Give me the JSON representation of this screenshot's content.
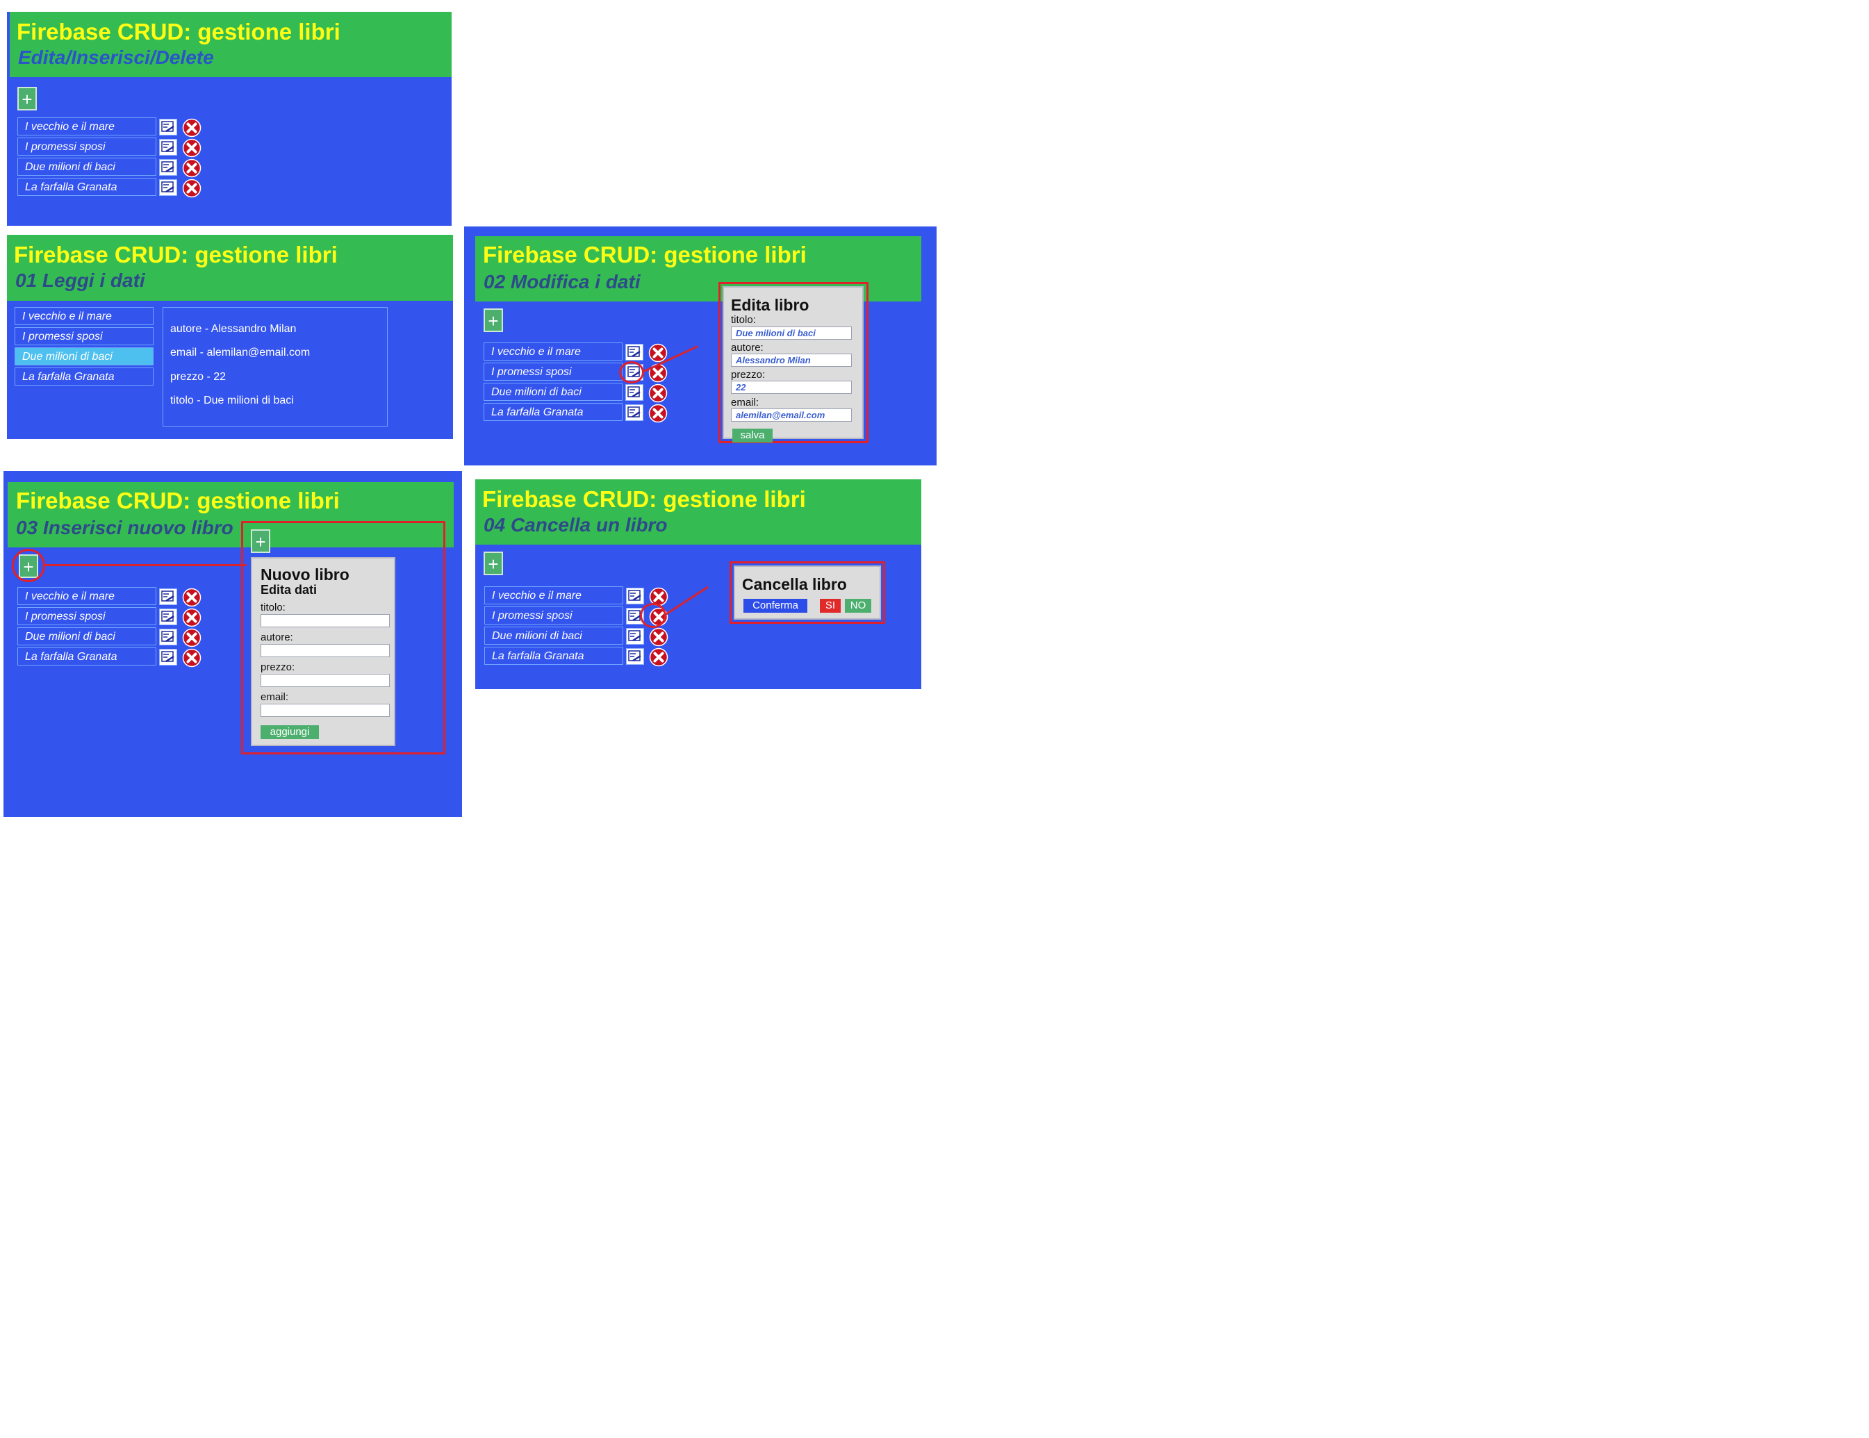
{
  "app_title": "Firebase CRUD: gestione libri",
  "subtitles": {
    "overview": "Edita/Inserisci/Delete",
    "read": "01 Leggi i dati",
    "edit": "02 Modifica i dati",
    "insert": "03 Inserisci nuovo libro",
    "delete": "04 Cancella un libro"
  },
  "add_button_label": "+",
  "books": [
    {
      "title": "I vecchio e il mare"
    },
    {
      "title": "I promessi sposi"
    },
    {
      "title": "Due milioni di baci"
    },
    {
      "title": "La farfalla Granata"
    }
  ],
  "read_panel": {
    "selected_index": 2,
    "details": [
      "autore - Alessandro Milan",
      "email - alemilan@email.com",
      "prezzo - 22",
      "titolo - Due milioni di baci"
    ]
  },
  "edit_dialog": {
    "heading": "Edita libro",
    "fields": [
      {
        "label": "titolo:",
        "value": "Due milioni di baci"
      },
      {
        "label": "autore:",
        "value": "Alessandro Milan"
      },
      {
        "label": "prezzo:",
        "value": "22"
      },
      {
        "label": "email:",
        "value": "alemilan@email.com"
      }
    ],
    "save_label": "salva"
  },
  "new_dialog": {
    "heading": "Nuovo libro",
    "subheading": "Edita dati",
    "fields": [
      {
        "label": "titolo:",
        "value": ""
      },
      {
        "label": "autore:",
        "value": ""
      },
      {
        "label": "prezzo:",
        "value": ""
      },
      {
        "label": "email:",
        "value": ""
      }
    ],
    "add_label": "aggiungi"
  },
  "delete_dialog": {
    "heading": "Cancella libro",
    "confirm_label": "Conferma",
    "yes_label": "SI",
    "no_label": "NO"
  },
  "icons": {
    "edit": "edit-icon",
    "delete": "delete-x-icon",
    "add": "plus-icon"
  },
  "colors": {
    "panel_blue": "#3454ee",
    "header_green": "#34bc52",
    "title_yellow": "#ffff14",
    "highlight_red": "#e0202a",
    "button_green": "#4caf6e",
    "selected_row": "#4ec0f0"
  }
}
